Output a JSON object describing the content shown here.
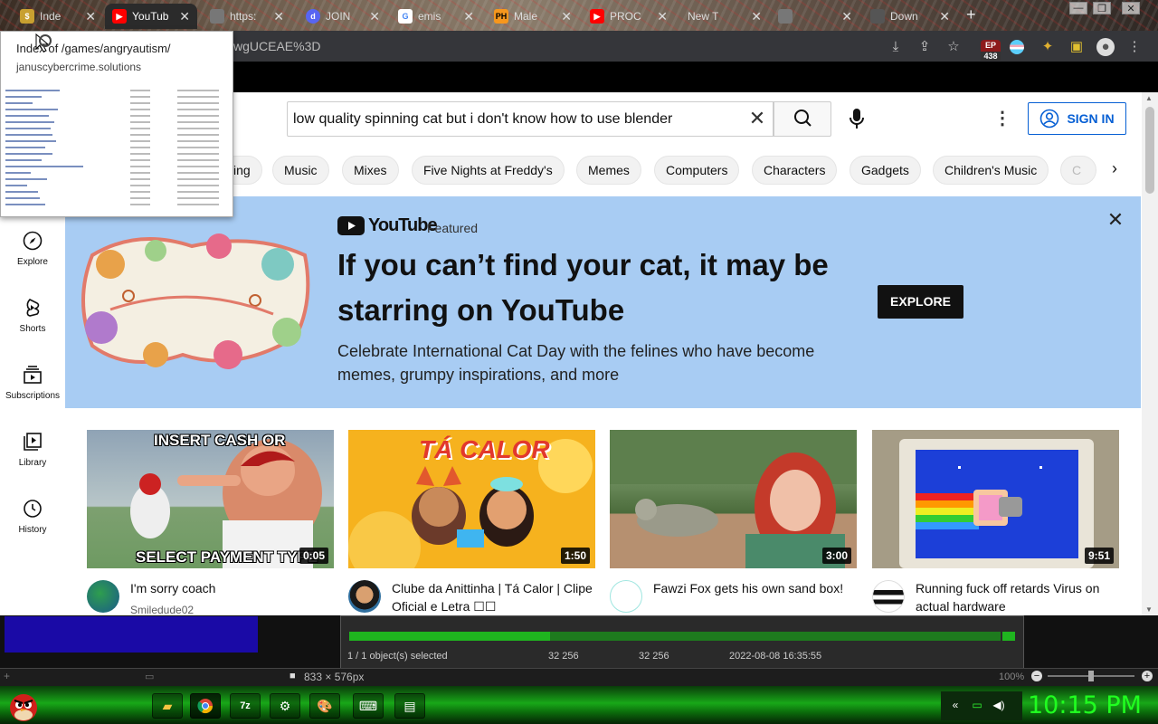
{
  "browser": {
    "tabs": [
      {
        "label": "Inde",
        "favicon": "coin-icon"
      },
      {
        "label": "YouTub",
        "favicon": "youtube-icon",
        "active": true
      },
      {
        "label": "https:",
        "favicon": "doc-icon"
      },
      {
        "label": "JOIN",
        "favicon": "discord-icon"
      },
      {
        "label": "emis",
        "favicon": "google-icon"
      },
      {
        "label": "Male",
        "favicon": "ph-icon"
      },
      {
        "label": "PROC",
        "favicon": "youtube-icon"
      },
      {
        "label": "New T",
        "favicon": "page-icon"
      },
      {
        "label": "",
        "favicon": "page-icon"
      },
      {
        "label": "Down",
        "favicon": "page-icon"
      }
    ],
    "new_tab": "+",
    "url_fragment": "wgUCEAE%3D",
    "extension_badge": "438",
    "extension_badge_top": "EP"
  },
  "popup": {
    "title": "Index of /games/angryautism/",
    "url": "januscybercrime.solutions"
  },
  "youtube": {
    "search_value": "low quality spinning cat but i don't know how to use blender",
    "signin": "SIGN IN",
    "chips": [
      "ing",
      "Music",
      "Mixes",
      "Five Nights at Freddy's",
      "Memes",
      "Computers",
      "Characters",
      "Gadgets",
      "Children's Music",
      "C"
    ],
    "sidebar": [
      {
        "label": "Explore",
        "icon": "compass-icon"
      },
      {
        "label": "Shorts",
        "icon": "shorts-icon"
      },
      {
        "label": "Subscriptions",
        "icon": "subscriptions-icon"
      },
      {
        "label": "Library",
        "icon": "library-icon"
      },
      {
        "label": "History",
        "icon": "history-icon"
      }
    ],
    "banner": {
      "logo": "YouTube",
      "featured": "Featured",
      "title": "If you can’t find your cat, it may be starring on YouTube",
      "subtitle": "Celebrate International Cat Day with the felines who have become memes, grumpy inspirations, and more",
      "button": "EXPLORE"
    },
    "videos": [
      {
        "title": "I'm sorry coach",
        "channel": "Smiledude02",
        "duration": "0:05",
        "thumb_text_top": "INSERT CASH OR",
        "thumb_text_bottom": "SELECT PAYMENT TYPE"
      },
      {
        "title": "Clube da Anittinha | Tá Calor | Clipe Oficial e Letra ☐☐",
        "channel": "",
        "duration": "1:50",
        "thumb_text_top": "TÁ CALOR",
        "thumb_text_bottom": ""
      },
      {
        "title": "Fawzi Fox gets his own sand box!",
        "channel": "",
        "duration": "3:00",
        "thumb_text_top": "",
        "thumb_text_bottom": ""
      },
      {
        "title": "Running fuck off retards Virus on actual hardware",
        "channel": "",
        "duration": "9:51",
        "thumb_text_top": "",
        "thumb_text_bottom": ""
      }
    ]
  },
  "editor": {
    "selection": "1 / 1 object(s) selected",
    "val1": "32 256",
    "val2": "32 256",
    "timestamp": "2022-08-08 16:35:55",
    "dimensions": "833 × 576px",
    "zoom": "100%"
  },
  "taskbar": {
    "clock": "10:15 PM",
    "apps": [
      "folder-icon",
      "chrome-icon",
      "7zip-icon",
      "app-icon",
      "paint-icon",
      "keyboard-icon",
      "notepad-icon"
    ]
  },
  "colors": {
    "yt_blue": "#065fd4",
    "banner_bg": "#a8ccf3",
    "clock_green": "#20ff20"
  }
}
